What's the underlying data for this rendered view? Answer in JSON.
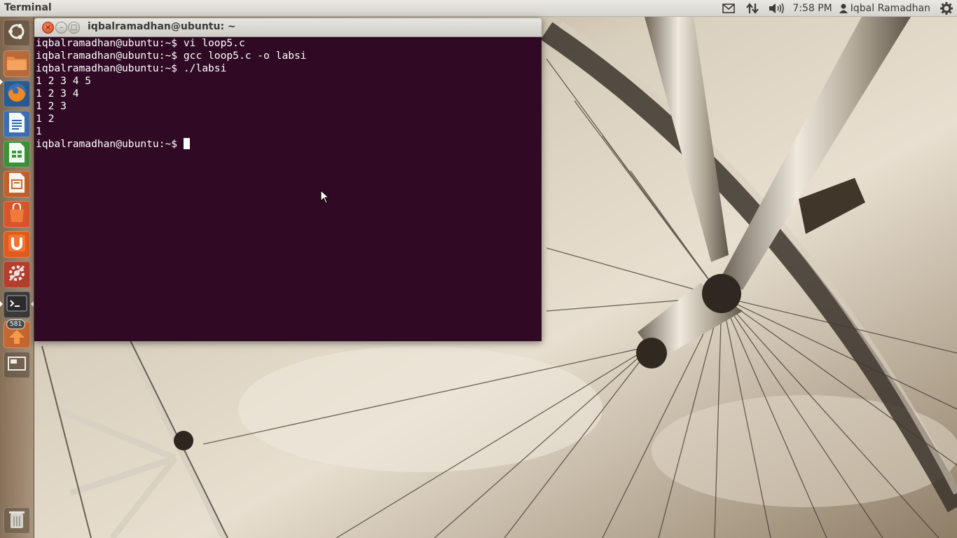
{
  "panel": {
    "app_title": "Terminal",
    "clock": "7:58 PM",
    "user_name": "Iqbal Ramadhan",
    "icons": [
      "mail-icon",
      "network-icon",
      "volume-icon",
      "user-icon",
      "gear-icon"
    ]
  },
  "launcher": {
    "items": [
      {
        "name": "dash-home",
        "icon": "ubuntu-logo-icon"
      },
      {
        "name": "files",
        "icon": "folder-icon"
      },
      {
        "name": "firefox",
        "icon": "firefox-icon"
      },
      {
        "name": "libreoffice-writer",
        "icon": "writer-icon"
      },
      {
        "name": "libreoffice-calc",
        "icon": "calc-icon"
      },
      {
        "name": "libreoffice-impress",
        "icon": "impress-icon"
      },
      {
        "name": "software-center",
        "icon": "shopping-bag-icon"
      },
      {
        "name": "ubuntu-one",
        "icon": "ubuntu-one-icon"
      },
      {
        "name": "system-settings",
        "icon": "settings-icon"
      },
      {
        "name": "terminal",
        "icon": "terminal-icon"
      },
      {
        "name": "update-manager",
        "icon": "update-icon"
      },
      {
        "name": "workspace-switcher",
        "icon": "workspace-icon"
      },
      {
        "name": "trash",
        "icon": "trash-icon"
      }
    ],
    "update_badge": "581"
  },
  "window": {
    "title": "iqbalramadhan@ubuntu: ~",
    "close_glyph": "×",
    "min_glyph": "–",
    "max_glyph": "□"
  },
  "terminal": {
    "lines": [
      "iqbalramadhan@ubuntu:~$ vi loop5.c",
      "iqbalramadhan@ubuntu:~$ gcc loop5.c -o labsi",
      "iqbalramadhan@ubuntu:~$ ./labsi",
      "1 2 3 4 5",
      "1 2 3 4",
      "1 2 3",
      "1 2",
      "1"
    ],
    "prompt": "iqbalramadhan@ubuntu:~$ "
  },
  "colors": {
    "terminal_bg": "#300a24",
    "close_button": "#e1552a",
    "panel_bg": "#dfddd6"
  }
}
